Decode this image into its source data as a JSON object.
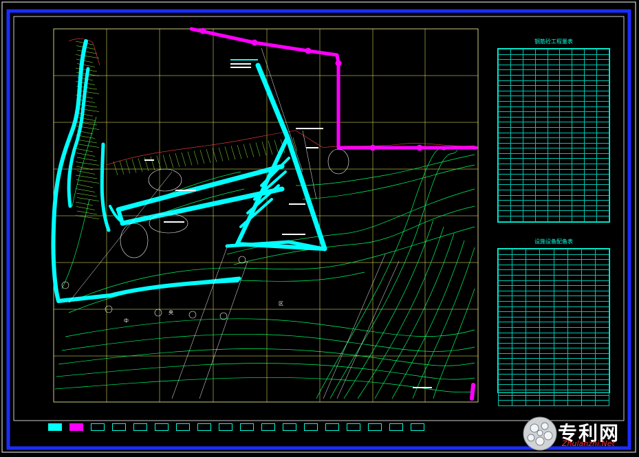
{
  "drawing": {
    "frame_color": "#1a2cff",
    "grid_color": "#ffff66",
    "contour_color": "#00ff66",
    "road_color": "#00ffff",
    "pipe_color": "#ff00ff",
    "table_color": "#00ffe0"
  },
  "tables": {
    "top": {
      "title": "钢筋砼工程量表",
      "rows": 33,
      "cols": 9
    },
    "bottom": {
      "title": "设施设备配备表",
      "rows": 30,
      "cols": 8
    }
  },
  "plan_labels": {
    "zone_1": "中",
    "zone_2": "央",
    "zone_3": "区"
  },
  "legend": {
    "items": [
      "",
      "",
      "",
      "",
      "",
      "",
      "",
      "",
      "",
      "",
      "",
      "",
      "",
      "",
      "",
      "",
      "",
      ""
    ],
    "note": ""
  },
  "watermark": {
    "text": "专利网",
    "url": "Zhulanzhi.Net"
  }
}
